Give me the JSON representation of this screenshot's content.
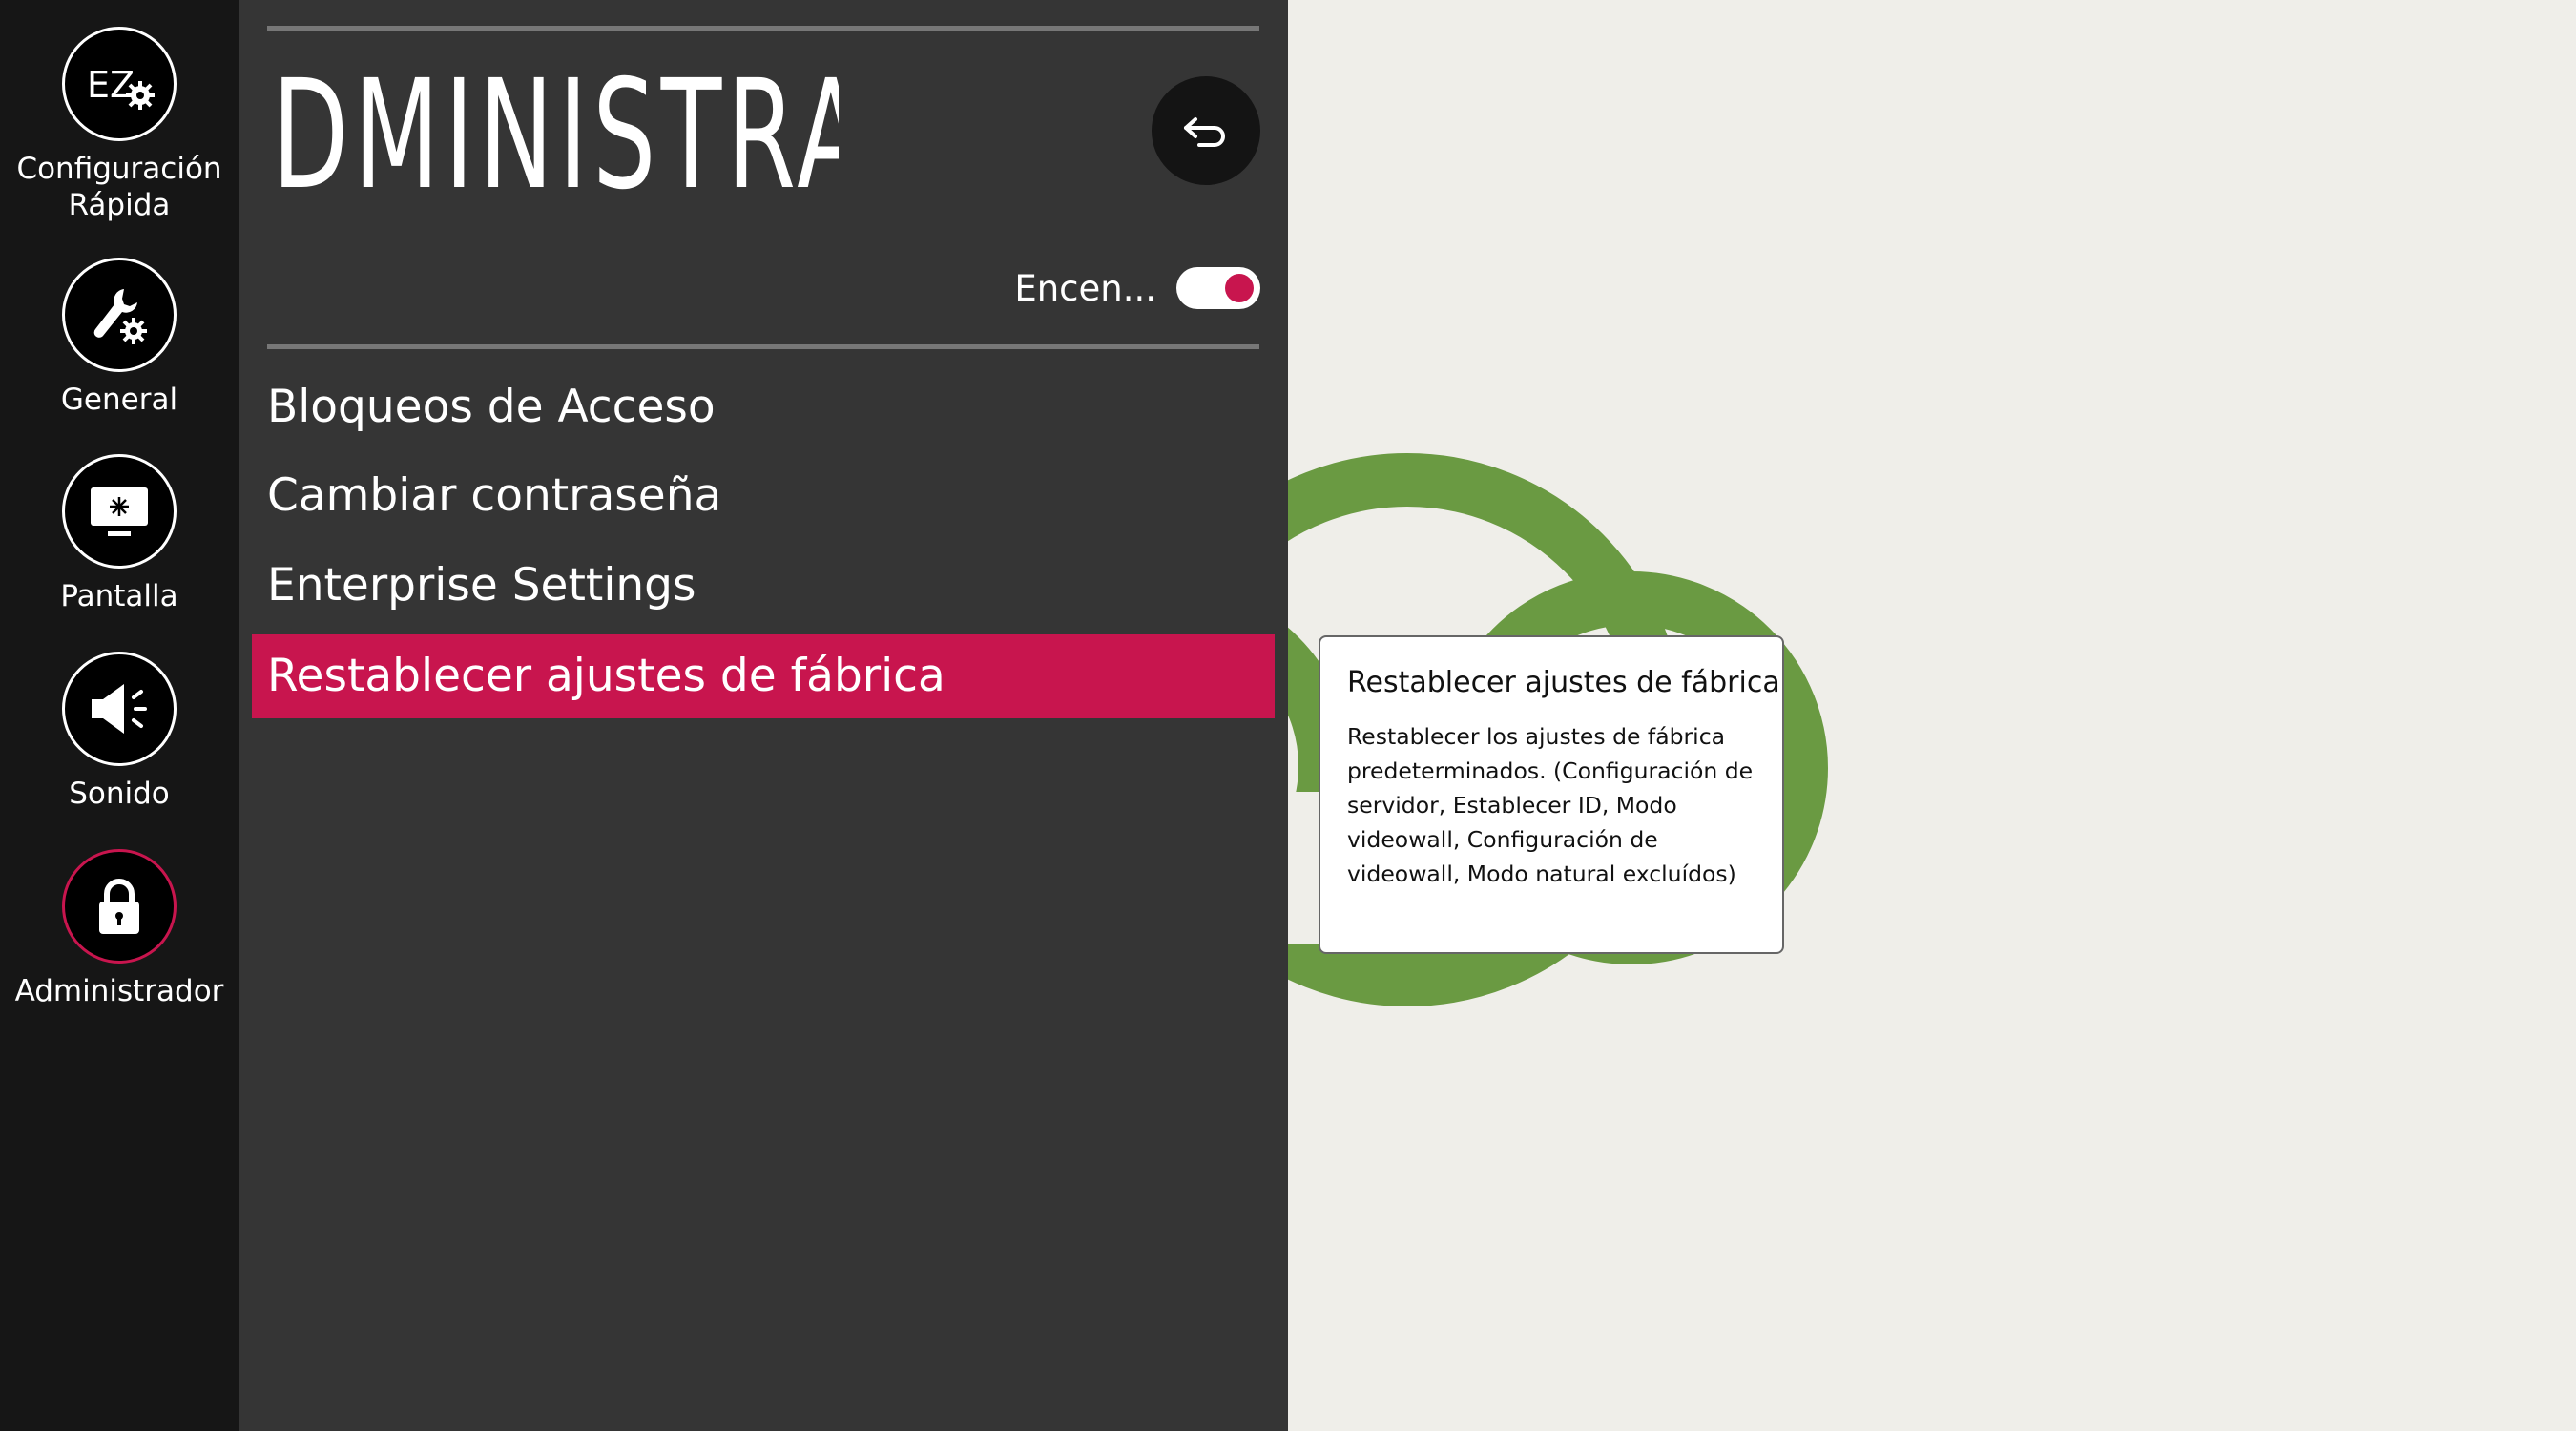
{
  "sidebar": {
    "items": [
      {
        "label_line1": "Configuración",
        "label_line2": "Rápida",
        "icon": "ez-setup-icon",
        "active": false
      },
      {
        "label_line1": "General",
        "icon": "wrench-gear-icon",
        "active": false
      },
      {
        "label_line1": "Pantalla",
        "icon": "monitor-icon",
        "active": false
      },
      {
        "label_line1": "Sonido",
        "icon": "speaker-icon",
        "active": false
      },
      {
        "label_line1": "Administrador",
        "icon": "lock-icon",
        "active": true
      }
    ],
    "ez_text": "EZ"
  },
  "panel": {
    "title": "DMINISTRADOR",
    "toggle": {
      "label": "Encen...",
      "state": "on"
    },
    "menu": [
      {
        "label": "Bloqueos de Acceso",
        "selected": false
      },
      {
        "label": "Cambiar contraseña",
        "selected": false
      },
      {
        "label": "Enterprise Settings",
        "selected": false
      },
      {
        "label": "Restablecer ajustes de fábrica",
        "selected": true
      }
    ]
  },
  "tooltip": {
    "title": "Restablecer ajustes de fábrica",
    "body": "Restablecer los ajustes de fábrica predeterminados. (Configuración de servidor, Establecer ID, Modo videowall, Configuración de videowall, Modo natural excluídos)"
  },
  "colors": {
    "accent": "#c8154e",
    "panel_bg": "#353535",
    "rail_bg": "#161616",
    "page_bg": "#efeee9",
    "cloud_green": "#6a9a42"
  }
}
